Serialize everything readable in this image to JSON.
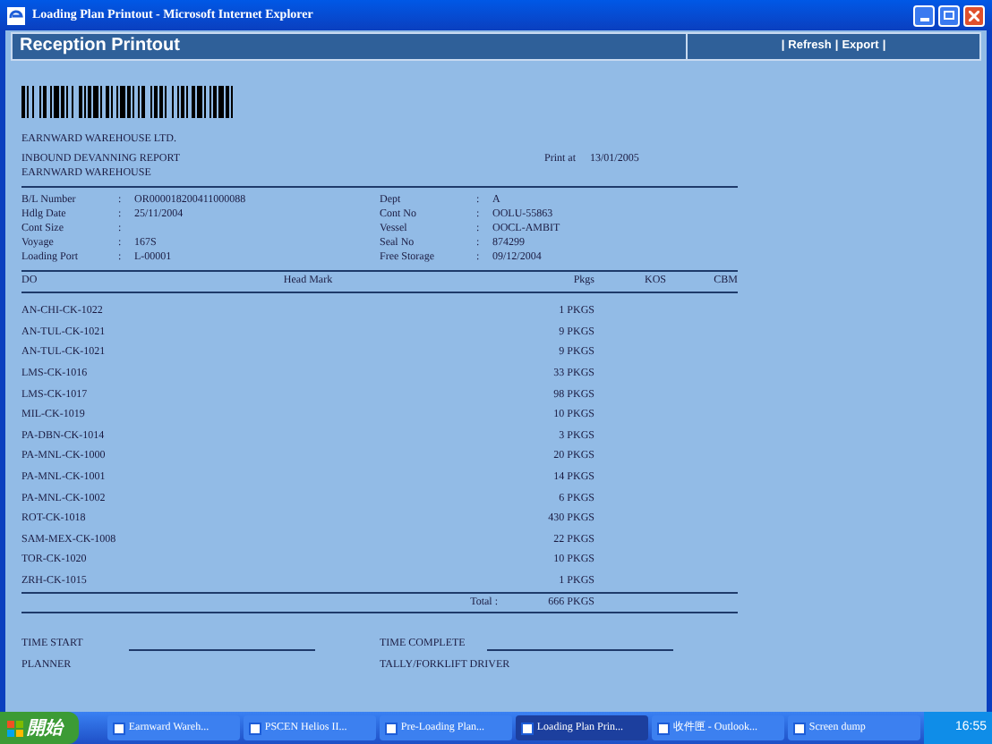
{
  "window": {
    "title": "Loading Plan Printout - Microsoft Internet Explorer"
  },
  "header": {
    "title": "Reception Printout",
    "separator": "|",
    "links": [
      "Refresh",
      "Export"
    ]
  },
  "report": {
    "company": "EARNWARD WAREHOUSE LTD.",
    "report_title": "INBOUND DEVANNING REPORT",
    "location": "EARNWARD WAREHOUSE",
    "print_at_label": "Print at",
    "print_at_value": "13/01/2005",
    "separator": ":",
    "fields_left": [
      {
        "label": "B/L Number",
        "value": "OR000018200411000088"
      },
      {
        "label": "Hdlg Date",
        "value": "25/11/2004"
      },
      {
        "label": "Cont Size"
      },
      {
        "label": "Voyage",
        "value": "167S"
      },
      {
        "label": "Loading Port",
        "value": "L-00001"
      }
    ],
    "fields_right": [
      {
        "label": "Dept",
        "value": "A"
      },
      {
        "label": "Cont No",
        "value": "OOLU-55863"
      },
      {
        "label": "Vessel",
        "value": "OOCL-AMBIT"
      },
      {
        "label": "Seal No",
        "value": "874299"
      },
      {
        "label": "Free Storage",
        "value": "09/12/2004"
      }
    ],
    "columns": [
      "DO",
      "Head Mark",
      "Pkgs",
      "KOS",
      "CBM"
    ],
    "rows": [
      {
        "do": "AN-CHI-CK-1022",
        "pkgs": "1 PKGS"
      },
      {
        "do": "AN-TUL-CK-1021",
        "pkgs": "9 PKGS"
      },
      {
        "do": "AN-TUL-CK-1021",
        "pkgs": "9 PKGS"
      },
      {
        "do": "LMS-CK-1016",
        "pkgs": "33 PKGS"
      },
      {
        "do": "LMS-CK-1017",
        "pkgs": "98 PKGS"
      },
      {
        "do": "MIL-CK-1019",
        "pkgs": "10 PKGS"
      },
      {
        "do": "PA-DBN-CK-1014",
        "pkgs": "3 PKGS"
      },
      {
        "do": "PA-MNL-CK-1000",
        "pkgs": "20 PKGS"
      },
      {
        "do": "PA-MNL-CK-1001",
        "pkgs": "14 PKGS"
      },
      {
        "do": "PA-MNL-CK-1002",
        "pkgs": "6 PKGS"
      },
      {
        "do": "ROT-CK-1018",
        "pkgs": "430 PKGS"
      },
      {
        "do": "SAM-MEX-CK-1008",
        "pkgs": "22 PKGS"
      },
      {
        "do": "TOR-CK-1020",
        "pkgs": "10 PKGS"
      },
      {
        "do": "ZRH-CK-1015",
        "pkgs": "1 PKGS"
      }
    ],
    "total_label": "Total :",
    "total_value": "666 PKGS",
    "signatures": [
      {
        "label": "TIME START",
        "line": true
      },
      {
        "label": "TIME COMPLETE",
        "line": true
      },
      {
        "label": "PLANNER",
        "line": false
      },
      {
        "label": "TALLY/FORKLIFT DRIVER",
        "line": false
      }
    ]
  },
  "taskbar": {
    "start": "開始",
    "items": [
      {
        "label": "Earnward Wareh...",
        "selected": false
      },
      {
        "label": "PSCEN Helios II...",
        "selected": false
      },
      {
        "label": "Pre-Loading Plan...",
        "selected": false
      },
      {
        "label": "Loading Plan Prin...",
        "selected": true
      },
      {
        "label": "收件匣 - Outlook...",
        "selected": false
      },
      {
        "label": "Screen dump",
        "selected": false
      }
    ],
    "clock": "16:55"
  }
}
